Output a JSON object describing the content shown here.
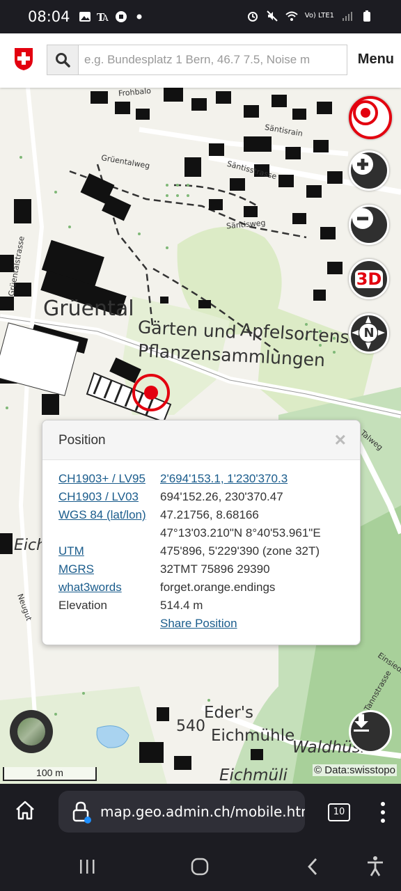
{
  "status_bar": {
    "time": "08:04",
    "network_label": "Vo) LTE1"
  },
  "header": {
    "search_placeholder": "e.g. Bundesplatz 1 Bern, 46.7 7.5, Noise m",
    "menu_label": "Menu"
  },
  "map": {
    "labels": {
      "gruental": "Grüental",
      "gaerten_line1": "Gärten und",
      "gaerten_line2": "Pflanzensammlungen",
      "apfelsorten": "Apfelsortensam",
      "eders": "Eder's",
      "eichmuehle": "Eichmühle",
      "elevation_540": "540",
      "waldhuesli": "Waldhüsli",
      "eichmuehli": "Eichmüli",
      "eich": "Eich",
      "saentisrain": "Säntisrain",
      "saentisstrasse": "Säntisstrasse",
      "saentisweg": "Säntisweg",
      "gruentalweg": "Grüentalweg",
      "gruentalstrasse": "Grüentalstrasse",
      "tannstrasse": "Tannstrasse",
      "einsiedler": "Einsiedl",
      "neugut": "Neugut",
      "fro": "Frohbalo",
      "tal": "Talweg"
    },
    "controls": {
      "location": "location-icon",
      "zoom_in": "zoom-in-icon",
      "zoom_out": "zoom-out-icon",
      "threed_label": "3D",
      "compass_label": "N"
    },
    "scale_label": "100 m",
    "attribution": "© Data:swisstopo"
  },
  "popup": {
    "title": "Position",
    "close_label": "×",
    "rows": [
      {
        "key": "CH1903+ / LV95",
        "value": "2'694'153.1, 1'230'370.3"
      },
      {
        "key": "CH1903 / LV03",
        "value": "694'152.26, 230'370.47"
      },
      {
        "key": "WGS 84 (lat/lon)",
        "value": "47.21756, 8.68166"
      },
      {
        "key": "",
        "value": "47°13'03.210\"N 8°40'53.961\"E"
      },
      {
        "key": "UTM",
        "value": "475'896, 5'229'390 (zone 32T)"
      },
      {
        "key": "MGRS",
        "value": "32TMT 75896 29390"
      },
      {
        "key": "what3words",
        "value": "forget.orange.endings"
      },
      {
        "key": "Elevation",
        "value": "514.4 m"
      },
      {
        "key": "",
        "value": "Share Position"
      }
    ]
  },
  "browser": {
    "url": "map.geo.admin.ch/mobile.html",
    "tab_count": "10"
  },
  "colors": {
    "accent_red": "#e3000f",
    "link_blue": "#1a5c8c",
    "forest_green": "#c5e0ba",
    "meadow_green": "#dcebc6"
  }
}
